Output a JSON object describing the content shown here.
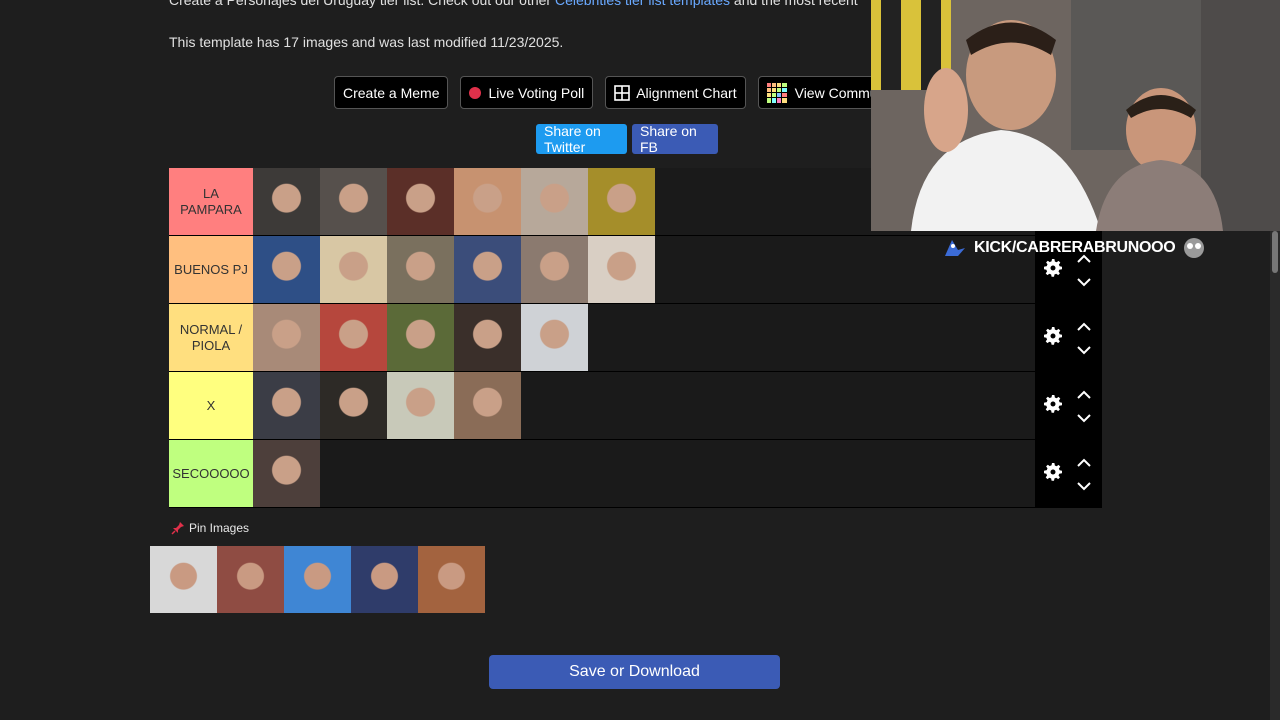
{
  "intro": {
    "text_before": "Create a Personajes del Uruguay tier list. Check out our other ",
    "link": "Celebrities tier list templates",
    "text_after": " and the most recent"
  },
  "modified": "This template has 17 images and was last modified 11/23/2025.",
  "buttons": {
    "create_meme": "Create a Meme",
    "live_poll": "Live Voting Poll",
    "alignment": "Alignment Chart",
    "view_community": "View Commu"
  },
  "share": {
    "twitter": "Share on Twitter",
    "fb": "Share on FB"
  },
  "tiers": [
    {
      "label": "LA PAMPARA",
      "color": "#ff7f7f",
      "items": [
        "#3d3a38",
        "#56504c",
        "#5b2f28",
        "#c79270",
        "#b7a89a",
        "#a58e2a"
      ]
    },
    {
      "label": "BUENOS PJ",
      "color": "#ffbf7f",
      "items": [
        "#2e4f86",
        "#d8c7a4",
        "#7a705e",
        "#3b4d7a",
        "#8b7a6f",
        "#d9cfc4"
      ]
    },
    {
      "label": "NORMAL / PIOLA",
      "color": "#ffdf7f",
      "items": [
        "#a88a78",
        "#b6473d",
        "#5b6a38",
        "#3a2f2a",
        "#cfd2d6"
      ]
    },
    {
      "label": "X",
      "color": "#ffff7f",
      "items": [
        "#3b3d46",
        "#2d2a26",
        "#c8c9b9",
        "#8a6c57"
      ]
    },
    {
      "label": "SECOOOOO",
      "color": "#bfff7f",
      "items": [
        "#4d3f3b"
      ]
    }
  ],
  "pin_label": "Pin Images",
  "pool_items": [
    "#d8d8d8",
    "#8f4c43",
    "#3f86d4",
    "#2f3c6a",
    "#a3633f"
  ],
  "save_label": "Save or Download",
  "stream_overlay": "KICK/CABRERABRUNOOO",
  "colors": {
    "accent_blue": "#3b5bb5",
    "twitter_blue": "#1d9bf0",
    "link_blue": "#6aa9ff"
  }
}
